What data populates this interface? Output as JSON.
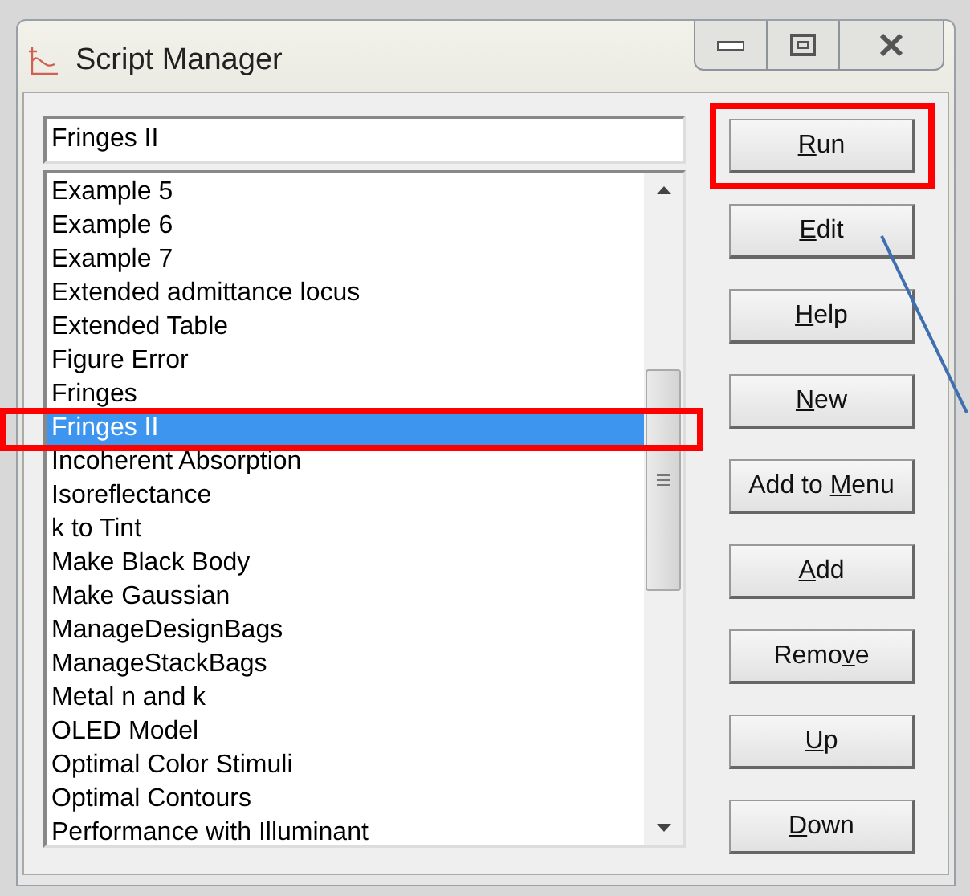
{
  "window": {
    "title": "Script Manager"
  },
  "script_name": {
    "value": "Fringes II"
  },
  "scripts": [
    {
      "label": "Example 5",
      "selected": false
    },
    {
      "label": "Example 6",
      "selected": false
    },
    {
      "label": "Example 7",
      "selected": false
    },
    {
      "label": "Extended admittance locus",
      "selected": false
    },
    {
      "label": "Extended Table",
      "selected": false
    },
    {
      "label": "Figure Error",
      "selected": false
    },
    {
      "label": "Fringes",
      "selected": false
    },
    {
      "label": "Fringes II",
      "selected": true
    },
    {
      "label": "Incoherent Absorption",
      "selected": false
    },
    {
      "label": "Isoreflectance",
      "selected": false
    },
    {
      "label": "k to Tint",
      "selected": false
    },
    {
      "label": "Make Black Body",
      "selected": false
    },
    {
      "label": "Make Gaussian",
      "selected": false
    },
    {
      "label": "ManageDesignBags",
      "selected": false
    },
    {
      "label": "ManageStackBags",
      "selected": false
    },
    {
      "label": "Metal n and k",
      "selected": false
    },
    {
      "label": "OLED Model",
      "selected": false
    },
    {
      "label": "Optimal Color Stimuli",
      "selected": false
    },
    {
      "label": "Optimal Contours",
      "selected": false
    },
    {
      "label": "Performance with Illuminant",
      "selected": false
    }
  ],
  "buttons": [
    {
      "parts": [
        {
          "text": "R",
          "underlined": true
        },
        {
          "text": "un",
          "underlined": false
        }
      ],
      "highlighted": true
    },
    {
      "parts": [
        {
          "text": "E",
          "underlined": true
        },
        {
          "text": "dit",
          "underlined": false
        }
      ],
      "highlighted": false
    },
    {
      "parts": [
        {
          "text": "H",
          "underlined": true
        },
        {
          "text": "elp",
          "underlined": false
        }
      ],
      "highlighted": false
    },
    {
      "parts": [
        {
          "text": "N",
          "underlined": true
        },
        {
          "text": "ew",
          "underlined": false
        }
      ],
      "highlighted": false
    },
    {
      "parts": [
        {
          "text": "Add to ",
          "underlined": false
        },
        {
          "text": "M",
          "underlined": true
        },
        {
          "text": "enu",
          "underlined": false
        }
      ],
      "highlighted": false
    },
    {
      "parts": [
        {
          "text": "A",
          "underlined": true
        },
        {
          "text": "dd",
          "underlined": false
        }
      ],
      "highlighted": false
    },
    {
      "parts": [
        {
          "text": "Remo",
          "underlined": false
        },
        {
          "text": "v",
          "underlined": true
        },
        {
          "text": "e",
          "underlined": false
        }
      ],
      "highlighted": false
    },
    {
      "parts": [
        {
          "text": "U",
          "underlined": true
        },
        {
          "text": "p",
          "underlined": false
        }
      ],
      "highlighted": false
    },
    {
      "parts": [
        {
          "text": "D",
          "underlined": true
        },
        {
          "text": "own",
          "underlined": false
        }
      ],
      "highlighted": false
    }
  ]
}
